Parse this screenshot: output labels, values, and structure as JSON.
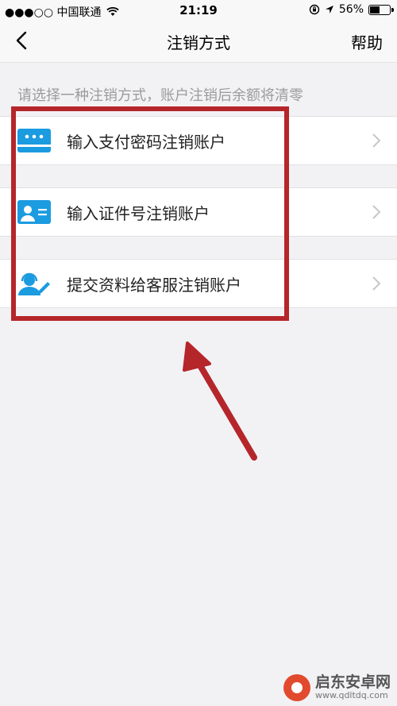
{
  "status_bar": {
    "carrier": "●●●○○ 中国联通",
    "time": "21:19",
    "battery_percent": "56%",
    "battery_level": 0.56
  },
  "nav": {
    "title": "注销方式",
    "help": "帮助"
  },
  "hint": "请选择一种注销方式，账户注销后余额将清零",
  "options": [
    {
      "label": "输入支付密码注销账户",
      "icon": "password-card-icon"
    },
    {
      "label": "输入证件号注销账户",
      "icon": "id-card-icon"
    },
    {
      "label": "提交资料给客服注销账户",
      "icon": "customer-service-icon"
    }
  ],
  "colors": {
    "accent_icon": "#1b9be0",
    "highlight": "#b5262a"
  },
  "watermark": {
    "title": "启东安卓网",
    "url": "www.qdltdq.com"
  }
}
